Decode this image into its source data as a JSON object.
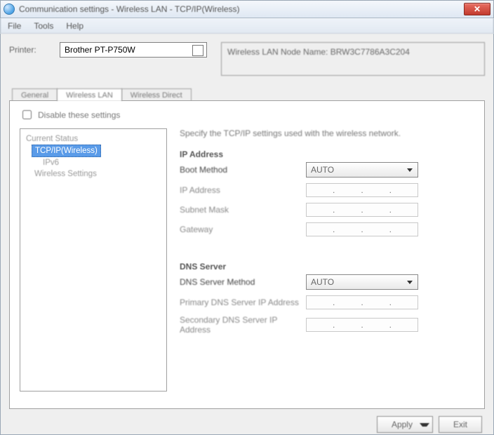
{
  "window": {
    "title": "Communication settings - Wireless LAN - TCP/IP(Wireless)"
  },
  "menu": {
    "file": "File",
    "tools": "Tools",
    "help": "Help"
  },
  "top": {
    "printer_label": "Printer:",
    "printer_value": "Brother PT-P750W",
    "status_text": "Wireless LAN Node Name: BRW3C7786A3C204"
  },
  "tabs": {
    "general": "General",
    "wireless_lan": "Wireless LAN",
    "wireless_direct": "Wireless Direct"
  },
  "panel": {
    "disable_label": "Disable these settings",
    "tree": {
      "root": "Current Status",
      "tcpip": "TCP/IP(Wireless)",
      "ipv6": "IPv6",
      "wireless_settings": "Wireless Settings"
    },
    "heading": "Specify the TCP/IP settings used with the wireless network.",
    "ip_section": {
      "title": "IP Address",
      "boot_method": "Boot Method",
      "boot_value": "AUTO",
      "ip_address": "IP Address",
      "subnet_mask": "Subnet Mask",
      "gateway": "Gateway"
    },
    "dns_section": {
      "title": "DNS Server",
      "dns_method": "DNS Server Method",
      "dns_value": "AUTO",
      "primary": "Primary DNS Server IP Address",
      "secondary": "Secondary DNS Server IP Address"
    }
  },
  "buttons": {
    "apply": "Apply",
    "exit": "Exit"
  }
}
